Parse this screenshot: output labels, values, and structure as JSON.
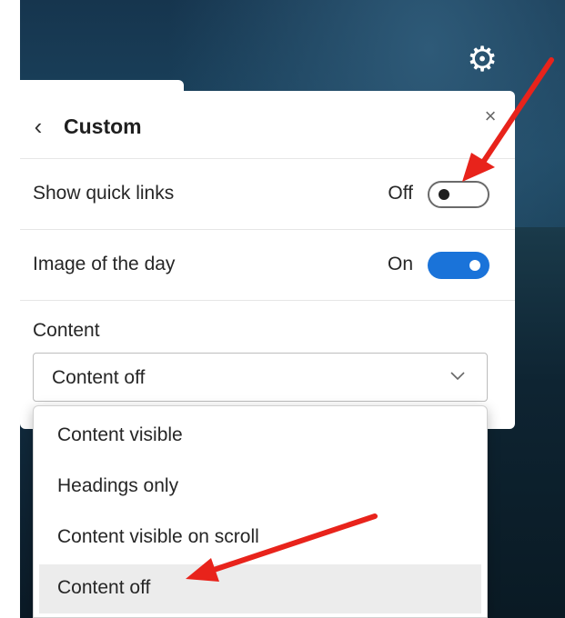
{
  "panel": {
    "title": "Custom",
    "back_icon": "chevron-left-icon",
    "close_icon": "close-icon"
  },
  "settings_icon": "gear-icon",
  "toggles": [
    {
      "label": "Show quick links",
      "state_text": "Off",
      "on": false
    },
    {
      "label": "Image of the day",
      "state_text": "On",
      "on": true
    }
  ],
  "content": {
    "label": "Content",
    "selected": "Content off",
    "options": [
      "Content visible",
      "Headings only",
      "Content visible on scroll",
      "Content off"
    ],
    "highlighted_index": 3
  },
  "colors": {
    "toggle_on": "#1a73d9",
    "annotation_arrow": "#e8231b"
  }
}
